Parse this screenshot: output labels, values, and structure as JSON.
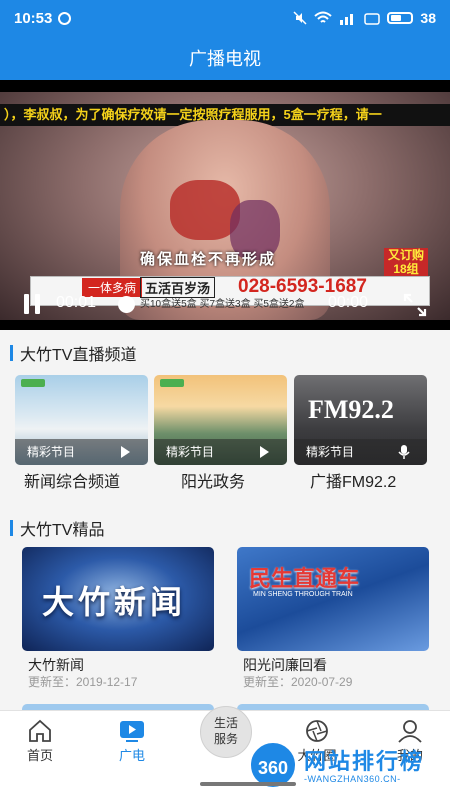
{
  "status_bar": {
    "time": "10:53",
    "battery": "38"
  },
  "header": {
    "title": "广播电视"
  },
  "player": {
    "ticker_text": "），李叔叔，为了确保疗效请一定按照疗程服用，5盒一疗程，请一",
    "caption_text": "确保血栓不再形成",
    "ad_phone": "028-6593-1687",
    "ad_product": "五活百岁汤",
    "ad_badge_line1": "又订购",
    "ad_badge_line2": "18组",
    "ad_left_text": "一体多病",
    "ad_sub_text": "买10盒送5盒  买7盒送3盒  买5盒送2盒",
    "current_time": "00:01",
    "total_time": "00:00",
    "progress": 0.0
  },
  "live_section": {
    "title": "大竹TV直播频道",
    "items": [
      {
        "tag": "精彩节目",
        "name": "新闻综合频道",
        "icon": "play-icon"
      },
      {
        "tag": "精彩节目",
        "name": "阳光政务",
        "icon": "play-icon"
      },
      {
        "tag": "精彩节目",
        "name": "广播FM92.2",
        "icon": "mic-icon",
        "overlay": "FM92.2"
      }
    ]
  },
  "premium_section": {
    "title": "大竹TV精品",
    "items": [
      {
        "name": "大竹新闻",
        "updated": "更新至：2019-12-17",
        "overlay": "大竹新闻"
      },
      {
        "name": "阳光问廉回看",
        "updated": "更新至：2020-07-29",
        "overlay": "民生直通车",
        "overlay_sub": "MIN SHENG THROUGH TRAIN"
      }
    ]
  },
  "bottom_nav": {
    "items": [
      {
        "label": "首页",
        "icon": "home-icon"
      },
      {
        "label": "广电",
        "icon": "tv-icon",
        "active": true
      },
      {
        "label": "大竹圈",
        "icon": "aperture-icon"
      },
      {
        "label": "我的",
        "icon": "user-icon"
      }
    ],
    "center": {
      "line1": "生活",
      "line2": "服务"
    }
  },
  "watermark": {
    "badge": "360",
    "text": "网站排行榜",
    "url": "-WANGZHAN360.CN-"
  },
  "colors": {
    "brand_blue": "#1e88e5",
    "ad_red": "#d3261f"
  }
}
